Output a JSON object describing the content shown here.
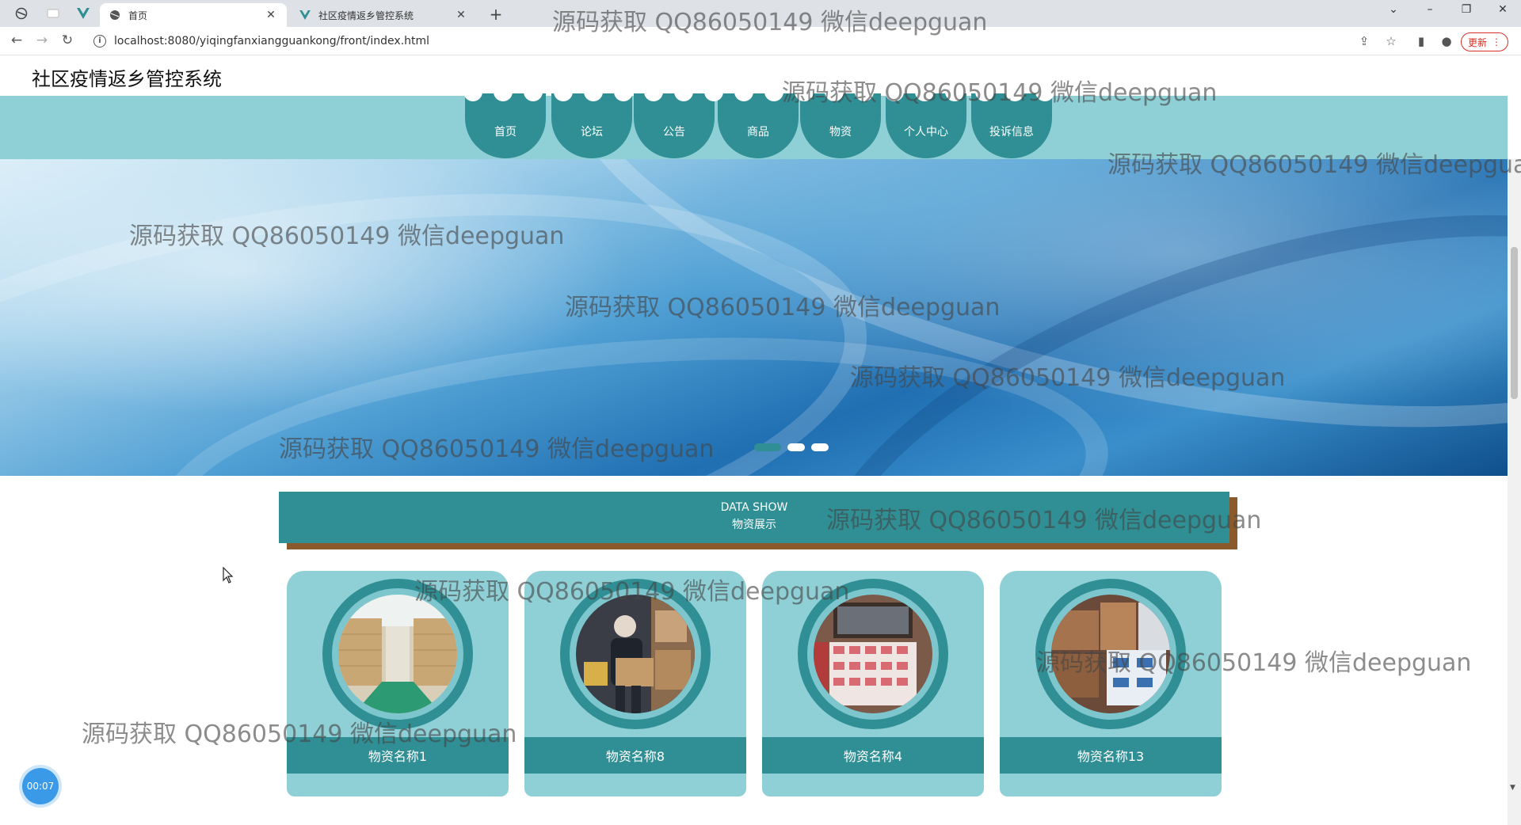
{
  "browser": {
    "tabs": [
      {
        "label": "首页",
        "icon": "globe-icon",
        "active": true
      },
      {
        "label": "社区疫情返乡管控系统",
        "icon": "vue-logo-icon",
        "active": false
      }
    ],
    "url": "localhost:8080/yiqingfanxiangguankong/front/index.html",
    "update_label": "更新"
  },
  "site": {
    "title": "社区疫情返乡管控系统",
    "nav": [
      "首页",
      "论坛",
      "公告",
      "商品",
      "物资",
      "个人中心",
      "投诉信息"
    ]
  },
  "banner": {
    "slides": 3,
    "active_slide": 0
  },
  "section": {
    "title_en": "DATA SHOW",
    "title_cn": "物资展示"
  },
  "cards": [
    {
      "name": "物资名称1",
      "image": "warehouse-photo"
    },
    {
      "name": "物资名称8",
      "image": "delivery-worker-photo"
    },
    {
      "name": "物资名称4",
      "image": "stacked-goods-photo"
    },
    {
      "name": "物资名称13",
      "image": "boxes-photo"
    }
  ],
  "timer": "00:07",
  "watermark": "源码获取 QQ86050149 微信deepguan",
  "colors": {
    "teal_dark": "#2f8f94",
    "teal_light": "#8fd0d7",
    "brown_shadow": "#8b5a2b"
  }
}
